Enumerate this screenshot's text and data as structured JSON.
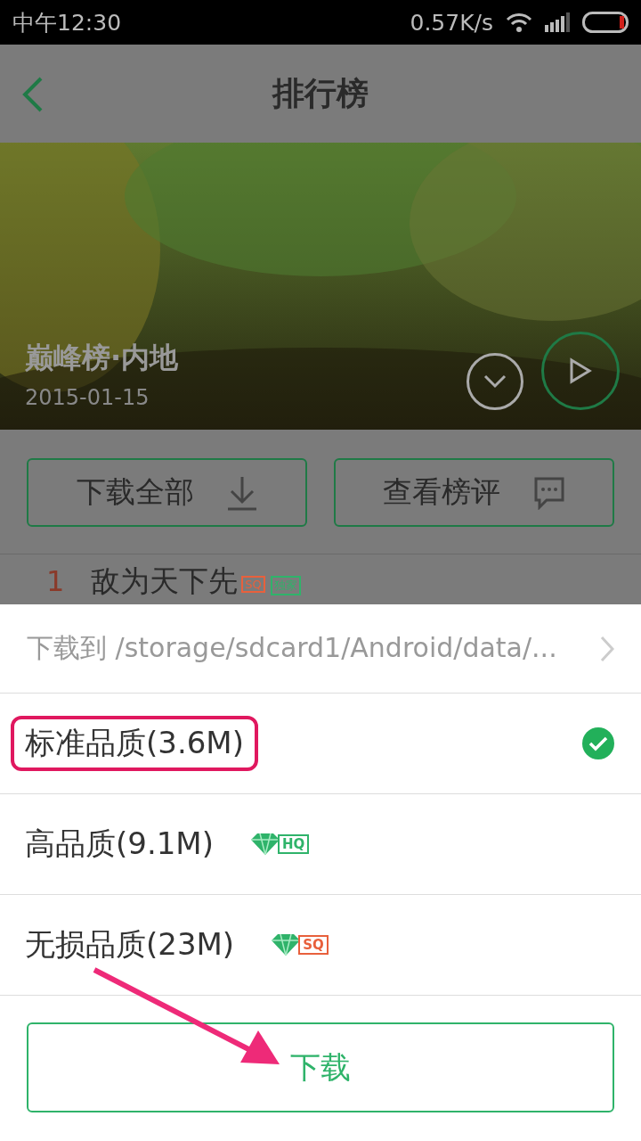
{
  "status_bar": {
    "time": "中午12:30",
    "speed": "0.57K/s"
  },
  "header": {
    "title": "排行榜"
  },
  "banner": {
    "kind": "picture",
    "title": "巅峰榜·内地",
    "date": "2015-01-15"
  },
  "actions": [
    {
      "label": "下载全部"
    },
    {
      "label": "查看榜评"
    }
  ],
  "song": {
    "rank": "1",
    "title": "敌为天下先",
    "badges": [
      {
        "text": "SQ",
        "color": "#e8603c"
      },
      {
        "text": "独家",
        "color": "#2fb36a"
      }
    ]
  },
  "sheet": {
    "path": "下载到 /storage/sdcard1/Android/data/...",
    "options": [
      {
        "label": "标准品质(3.6M)",
        "selected": true,
        "annotated": true
      },
      {
        "label": "高品质(9.1M)",
        "selected": false,
        "annotated": false,
        "badge": {
          "text": "HQ",
          "color": "#2fb36a"
        }
      },
      {
        "label": "无损品质(23M)",
        "selected": false,
        "annotated": false,
        "badge": {
          "text": "SQ",
          "color": "#e8603c"
        }
      }
    ],
    "button": "下载"
  }
}
